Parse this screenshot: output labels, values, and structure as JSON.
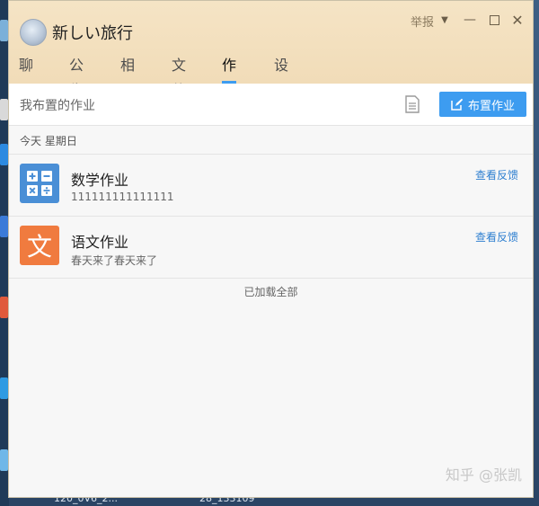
{
  "window": {
    "group_name": "新しい旅行",
    "report_label": "举报",
    "tabs": [
      {
        "label": "聊天"
      },
      {
        "label": "公告"
      },
      {
        "label": "相册"
      },
      {
        "label": "文件"
      },
      {
        "label": "作业"
      },
      {
        "label": "设置"
      }
    ],
    "active_tab": "作业"
  },
  "toolbar": {
    "title": "我布置的作业",
    "assign_label": "布置作业"
  },
  "list": {
    "date_label": "今天 星期日",
    "items": [
      {
        "title": "数学作业",
        "desc": "111111111111111",
        "feedback": "查看反馈",
        "icon": "calculator-icon",
        "color": "#4a8fd6"
      },
      {
        "title": "语文作业",
        "desc": "春天来了春天来了",
        "feedback": "查看反馈",
        "icon": "chinese-character-icon",
        "icon_text": "文",
        "color": "#f07b3f"
      }
    ],
    "loaded_label": "已加载全部"
  },
  "desktop": {
    "bottom_texts": [
      "120_0V6_2...",
      "28_133109"
    ]
  },
  "watermark": "知乎 @张凯"
}
